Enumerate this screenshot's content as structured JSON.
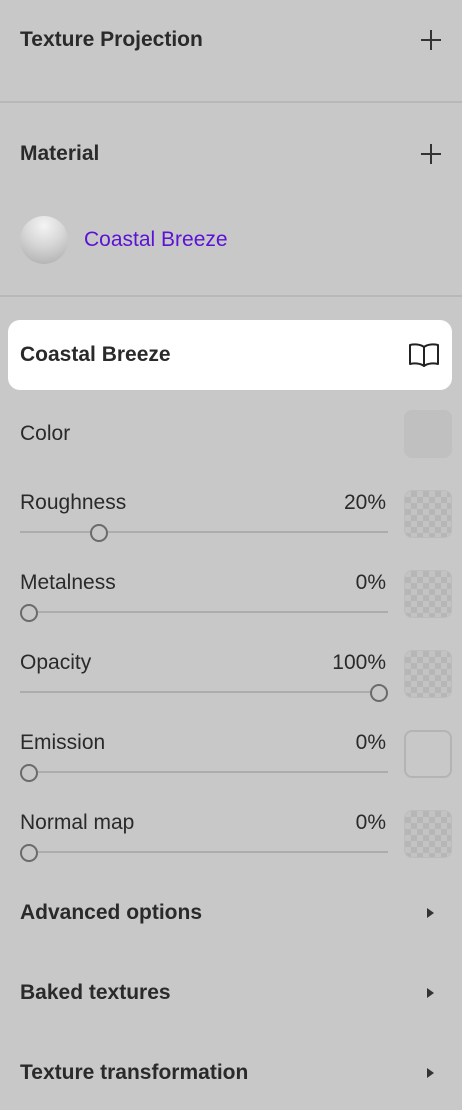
{
  "texture_projection": {
    "title": "Texture Projection",
    "add_icon": "plus-icon"
  },
  "material": {
    "title": "Material",
    "add_icon": "plus-icon",
    "selected_name": "Coastal Breeze"
  },
  "card": {
    "title": "Coastal Breeze",
    "icon": "book-icon"
  },
  "properties": {
    "color": {
      "label": "Color"
    },
    "roughness": {
      "label": "Roughness",
      "value": "20%",
      "level": 0.2
    },
    "metalness": {
      "label": "Metalness",
      "value": "0%",
      "level": 0
    },
    "opacity": {
      "label": "Opacity",
      "value": "100%",
      "level": 1.0
    },
    "emission": {
      "label": "Emission",
      "value": "0%",
      "level": 0
    },
    "normal_map": {
      "label": "Normal map",
      "value": "0%",
      "level": 0
    }
  },
  "sections": {
    "advanced": "Advanced options",
    "baked": "Baked textures",
    "transformation": "Texture transformation"
  },
  "colors": {
    "accent": "#5b12d6",
    "background": "#c8c8c8",
    "card": "#ffffff"
  }
}
